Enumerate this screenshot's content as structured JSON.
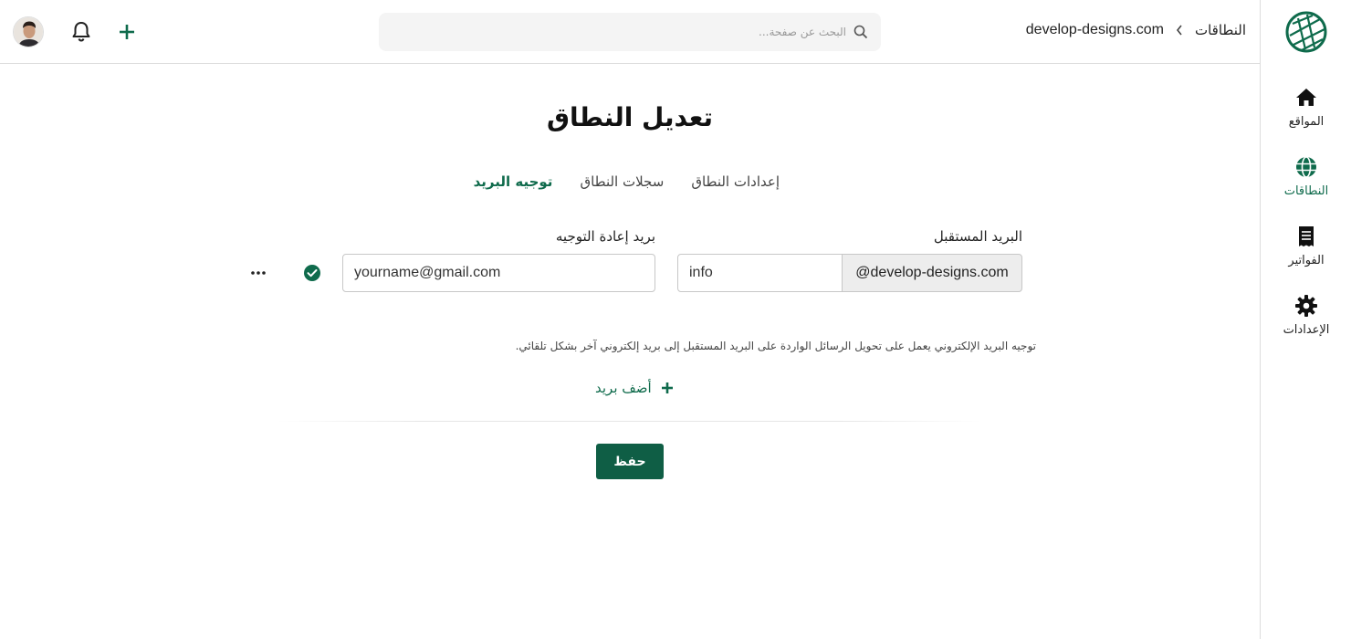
{
  "colors": {
    "accent": "#0f6b4c",
    "button_bg": "#0f5e45",
    "border": "#dcdcdc"
  },
  "sidebar": {
    "logo_icon": "globe-outline-logo",
    "items": [
      {
        "label": "المواقع",
        "icon": "home-icon"
      },
      {
        "label": "النطاقات",
        "icon": "globe-icon",
        "active": true
      },
      {
        "label": "الفواتير",
        "icon": "receipt-icon"
      },
      {
        "label": "الإعدادات",
        "icon": "gear-icon"
      }
    ]
  },
  "header": {
    "breadcrumb": {
      "section": "النطاقات",
      "domain": "develop-designs.com"
    },
    "search_placeholder": "البحث عن صفحة...",
    "search_icon": "search-icon",
    "bell_icon": "bell-icon",
    "add_icon": "plus-icon",
    "avatar_icon": "user-avatar"
  },
  "main": {
    "title": "تعديل النطاق",
    "tabs": [
      {
        "label": "إعدادات النطاق"
      },
      {
        "label": "سجلات النطاق"
      },
      {
        "label": "توجيه البريد",
        "active": true
      }
    ],
    "form": {
      "incoming_label": "البريد المستقبل",
      "forward_label": "بريد إعادة التوجيه",
      "domain_suffix": "@develop-designs.com",
      "local_part_value": "info",
      "forward_value": "yourname@gmail.com",
      "status_icon": "check-circle-icon",
      "more_icon": "more-horizontal-icon"
    },
    "help_text": "توجيه البريد الإلكتروني يعمل على تحويل الرسائل الواردة على البريد المستقبل إلى بريد إلكتروني آخر بشكل تلقائي.",
    "add_label": "أضف بريد",
    "save_label": "حفظ"
  }
}
